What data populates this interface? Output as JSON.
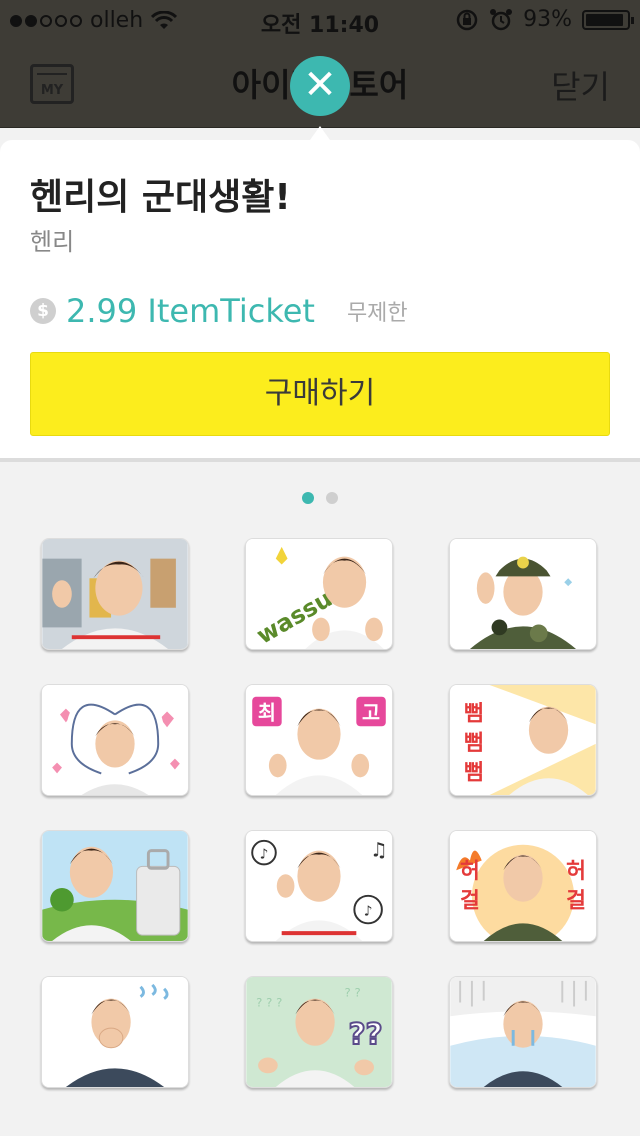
{
  "status_bar": {
    "carrier": "olleh",
    "time": "오전 11:40",
    "battery": "93%",
    "battery_level": 0.93,
    "icons": [
      "signal-dots-icon",
      "wifi-icon",
      "orientation-lock-icon",
      "alarm-icon",
      "battery-icon"
    ]
  },
  "nav": {
    "my_label": "MY",
    "title": "아이템스토어",
    "close_label": "닫기"
  },
  "dismiss_icon": "close-x-icon",
  "item": {
    "title": "헨리의 군대생활!",
    "artist": "헨리",
    "currency_icon": "dollar-coin-icon",
    "price": "2.99 ItemTicket",
    "period": "무제한",
    "buy_label": "구매하기"
  },
  "pager": {
    "pages": 2,
    "current": 1
  },
  "stickers": [
    {
      "name": "sticker-waving",
      "text": ""
    },
    {
      "name": "sticker-wassup",
      "text": "wassup!"
    },
    {
      "name": "sticker-salute",
      "text": ""
    },
    {
      "name": "sticker-heart-arms",
      "text": ""
    },
    {
      "name": "sticker-thumbs-up",
      "text": "최 고"
    },
    {
      "name": "sticker-bbam",
      "text": "뻠뻠뻠"
    },
    {
      "name": "sticker-suitcase",
      "text": ""
    },
    {
      "name": "sticker-music",
      "text": ""
    },
    {
      "name": "sticker-angry-army",
      "text": "허 걸"
    },
    {
      "name": "sticker-worried",
      "text": ""
    },
    {
      "name": "sticker-confused",
      "text": "??"
    },
    {
      "name": "sticker-crying",
      "text": ""
    }
  ],
  "colors": {
    "accent": "#3db8b0",
    "buy_button": "#fced1d",
    "dim_header": "#3e3c36"
  }
}
